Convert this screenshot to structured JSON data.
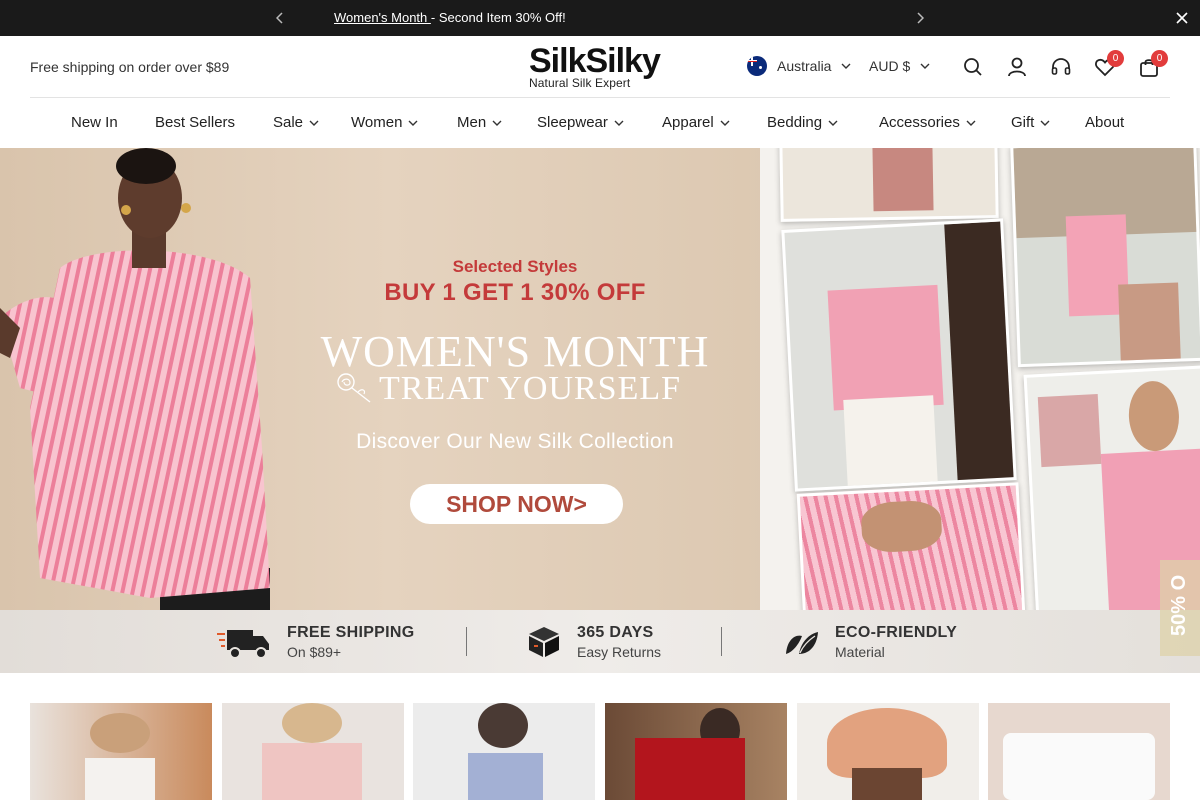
{
  "announcement": {
    "link_text": "Women's Month ",
    "rest_text": "- Second Item 30% Off!"
  },
  "header": {
    "shipping_text": "Free shipping on order over $89",
    "logo_brand": "SilkSilky",
    "logo_tagline": "Natural Silk Expert",
    "region": "Australia",
    "currency": "AUD $",
    "wishlist_count": "0",
    "cart_count": "0"
  },
  "nav": {
    "items": [
      {
        "label": "New In"
      },
      {
        "label": "Best Sellers"
      },
      {
        "label": "Sale"
      },
      {
        "label": "Women"
      },
      {
        "label": "Men"
      },
      {
        "label": "Sleepwear"
      },
      {
        "label": "Apparel"
      },
      {
        "label": "Bedding"
      },
      {
        "label": "Accessories"
      },
      {
        "label": "Gift"
      },
      {
        "label": "About"
      }
    ]
  },
  "hero": {
    "selected": "Selected Styles",
    "offer": "BUY 1 GET 1 30% OFF",
    "headline": "WOMEN'S MONTH",
    "subheadline": "TREAT YOURSELF",
    "discover": "Discover Our New Silk Collection",
    "cta": "SHOP NOW>"
  },
  "benefits": [
    {
      "title": "FREE SHIPPING",
      "sub": "On $89+",
      "icon": "truck-icon"
    },
    {
      "title": "365 DAYS",
      "sub": "Easy Returns",
      "icon": "box-icon"
    },
    {
      "title": "ECO-FRIENDLY",
      "sub": "Material",
      "icon": "leaf-icon"
    }
  ],
  "side_tab": "50% O",
  "colors": {
    "announce_bg": "#1a1a1a",
    "badge": "#e23c3c",
    "offer_red": "#c43a3a",
    "shirt_pink": "#f3a6b8"
  }
}
